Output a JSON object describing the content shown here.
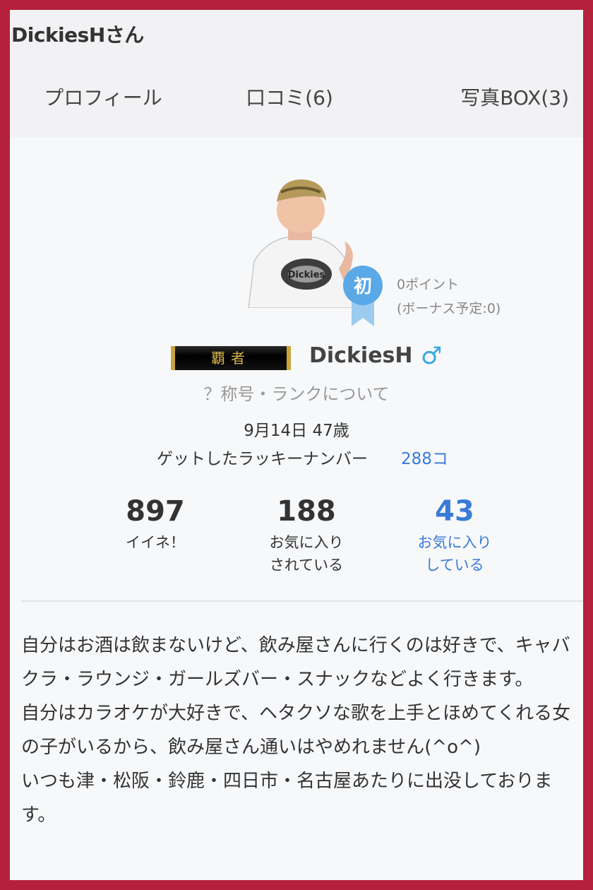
{
  "header": {
    "title": "DickiesHさん"
  },
  "tabs": [
    {
      "label": "プロフィール",
      "active": true
    },
    {
      "label": "口コミ(6)",
      "active": false
    },
    {
      "label": "写真BOX(3)",
      "active": false
    }
  ],
  "profile": {
    "badge_label": "初",
    "points": "0ポイント",
    "bonus": "(ボーナス予定:0)",
    "rank_plate": "覇者",
    "username": "DickiesH",
    "gender_icon": "♂",
    "rank_link": "？称号・ランクについて",
    "birthday": "9月14日 47歳",
    "lucky_label": "ゲットしたラッキーナンバー",
    "lucky_count": "288コ"
  },
  "stats": [
    {
      "number": "897",
      "label": "イイネ！"
    },
    {
      "number": "188",
      "label1": "お気に入り",
      "label2": "されている"
    },
    {
      "number": "43",
      "label1": "お気に入り",
      "label2": "している"
    }
  ],
  "bio": {
    "lines": [
      "自分はお酒は飲まないけど、飲み屋さんに行くのは好きで、キャバクラ・ラウンジ・ガールズバー・スナックなどよく行きます。",
      "自分はカラオケが大好きで、ヘタクソな歌を上手とほめてくれる女の子がいるから、飲み屋さん通いはやめれません(^o^)",
      "いつも津・松阪・鈴鹿・四日市・名古屋あたりに出没しております。"
    ]
  },
  "colors": {
    "frame": "#b5213a",
    "active_tab_underline": "#d21f2a",
    "link_blue": "#3a7bd5",
    "gender_blue": "#38a8e0",
    "badge_blue": "#5aa8e6"
  }
}
